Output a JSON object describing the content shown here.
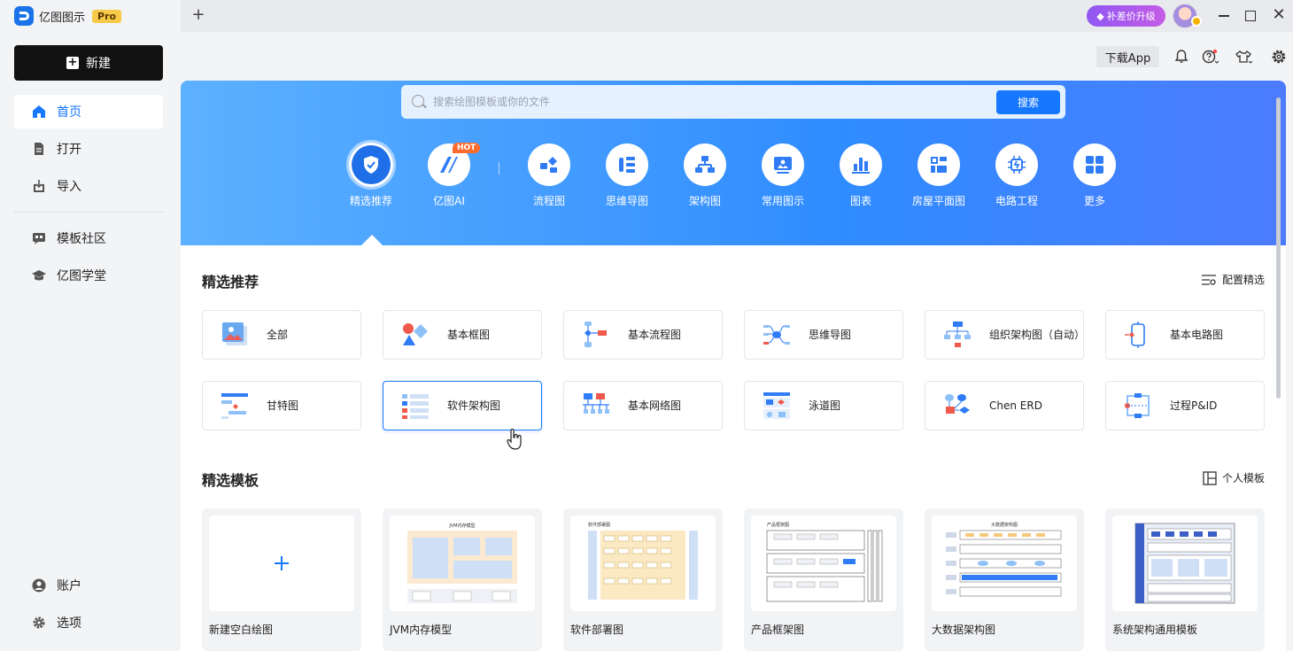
{
  "app": {
    "name": "亿图图示",
    "badge": "Pro",
    "new_tab": "+"
  },
  "titlebar": {
    "upgrade_label": "补差价升级",
    "close": "✕"
  },
  "sidebar": {
    "new_label": "新建",
    "items": [
      {
        "label": "首页",
        "icon": "home-icon",
        "active": true
      },
      {
        "label": "打开",
        "icon": "file-icon"
      },
      {
        "label": "导入",
        "icon": "import-icon"
      },
      {
        "label": "模板社区",
        "icon": "community-icon"
      },
      {
        "label": "亿图学堂",
        "icon": "graduation-cap-icon"
      }
    ],
    "bottom": [
      {
        "label": "账户",
        "icon": "account-icon"
      },
      {
        "label": "选项",
        "icon": "gear-icon"
      }
    ]
  },
  "toolbar": {
    "download_label": "下载App"
  },
  "search": {
    "placeholder": "搜索绘图模板或你的文件",
    "button": "搜索"
  },
  "categories": [
    {
      "label": "精选推荐",
      "icon": "featured-icon",
      "selected": true
    },
    {
      "label": "亿图AI",
      "icon": "ai-icon",
      "hot": "HOT"
    },
    {
      "label": "流程图",
      "icon": "flowchart-icon"
    },
    {
      "label": "思维导图",
      "icon": "mindmap-icon"
    },
    {
      "label": "架构图",
      "icon": "org-chart-icon"
    },
    {
      "label": "常用图示",
      "icon": "diagram-icon"
    },
    {
      "label": "图表",
      "icon": "bar-chart-icon"
    },
    {
      "label": "房屋平面图",
      "icon": "floorplan-icon"
    },
    {
      "label": "电路工程",
      "icon": "circuit-icon"
    },
    {
      "label": "更多",
      "icon": "grid-icon"
    }
  ],
  "featured": {
    "title": "精选推荐",
    "action": "配置精选",
    "types": [
      {
        "label": "全部"
      },
      {
        "label": "基本框图"
      },
      {
        "label": "基本流程图"
      },
      {
        "label": "思维导图"
      },
      {
        "label": "组织架构图（自动）"
      },
      {
        "label": "基本电路图"
      },
      {
        "label": "甘特图"
      },
      {
        "label": "软件架构图"
      },
      {
        "label": "基本网络图"
      },
      {
        "label": "泳道图"
      },
      {
        "label": "Chen ERD"
      },
      {
        "label": "过程P&ID"
      }
    ]
  },
  "templates": {
    "title": "精选模板",
    "action": "个人模板",
    "items": [
      {
        "label": "新建空白绘图"
      },
      {
        "label": "JVM内存模型",
        "preview_title": "JVM内存模型"
      },
      {
        "label": "软件部署图",
        "preview_title": "软件部署图"
      },
      {
        "label": "产品框架图",
        "preview_title": "产品框架图"
      },
      {
        "label": "大数据架构图",
        "preview_title": "大数据架构图"
      },
      {
        "label": "系统架构通用模板"
      }
    ]
  }
}
